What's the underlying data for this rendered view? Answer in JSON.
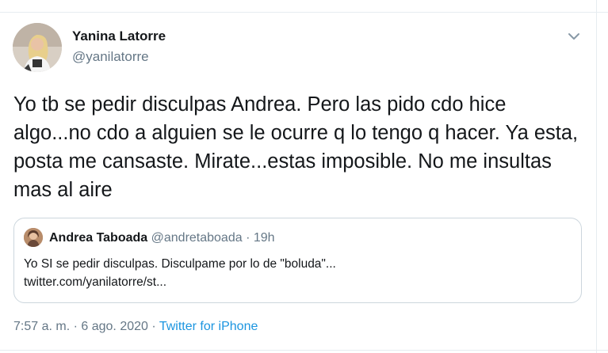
{
  "tweet": {
    "author": {
      "name": "Yanina Latorre",
      "handle": "@yanilatorre"
    },
    "text": "Yo tb se pedir disculpas Andrea. Pero las pido cdo hice algo...no cdo a alguien se le ocurre q lo tengo q hacer. Ya esta, posta me cansaste. Mirate...estas imposible. No me insultas mas al aire",
    "quoted": {
      "name": "Andrea Taboada",
      "handle": "@andretaboada",
      "separator": "·",
      "time": "19h",
      "text_line1": "Yo SI se pedir disculpas. Disculpame por lo de \"boluda\"...",
      "text_line2": "twitter.com/yanilatorre/st..."
    },
    "footer": {
      "time": "7:57 a. m.",
      "separator": "·",
      "date": "6 ago. 2020",
      "source": "Twitter for iPhone"
    }
  },
  "colors": {
    "text": "#14171a",
    "secondary": "#657786",
    "link": "#1b95e0",
    "border": "#ccd6dd"
  },
  "icons": {
    "menu": "chevron-down-icon"
  }
}
